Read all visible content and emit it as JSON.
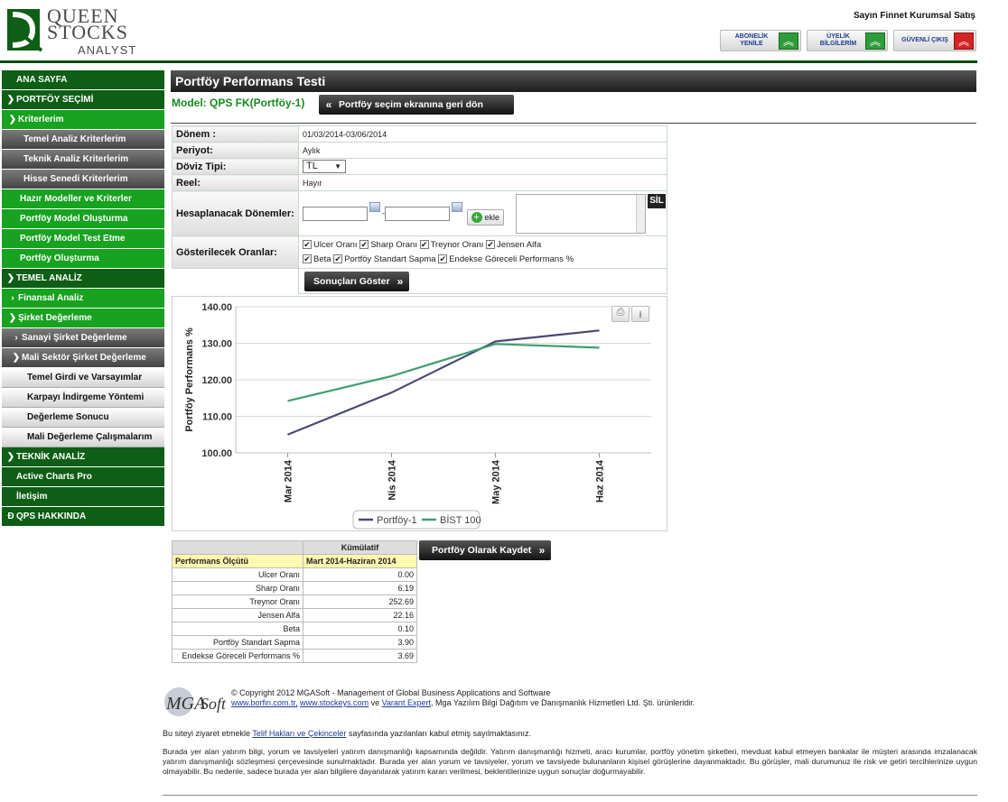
{
  "logo": {
    "line1": "QUEEN",
    "line2": "STOCKS",
    "line3": "ANALYST"
  },
  "header": {
    "user": "Sayın Finnet Kurumsal Satış",
    "buttons": [
      {
        "label": "ABONELİK YENİLE"
      },
      {
        "label": "ÜYELİK BİLGİLERİM"
      },
      {
        "label": "GÜVENLİ ÇIKIŞ"
      }
    ]
  },
  "sidebar": {
    "items": [
      {
        "label": "ANA SAYFA"
      },
      {
        "label": "PORTFÖY SEÇİMİ"
      },
      {
        "label": "Kriterlerim"
      },
      {
        "label": "Temel Analiz Kriterlerim"
      },
      {
        "label": "Teknik Analiz Kriterlerim"
      },
      {
        "label": "Hisse Senedi Kriterlerim"
      },
      {
        "label": "Hazır Modeller ve Kriterler"
      },
      {
        "label": "Portföy Model Oluşturma"
      },
      {
        "label": "Portföy Model Test Etme"
      },
      {
        "label": "Portföy Oluşturma"
      },
      {
        "label": "TEMEL ANALİZ"
      },
      {
        "label": "Finansal Analiz"
      },
      {
        "label": "Şirket Değerleme"
      },
      {
        "label": "Sanayi Şirket Değerleme"
      },
      {
        "label": "Mali Sektör Şirket Değerleme"
      },
      {
        "label": "Temel Girdi ve Varsayımlar"
      },
      {
        "label": "Karpayı İndirgeme Yöntemi"
      },
      {
        "label": "Değerleme Sonucu"
      },
      {
        "label": "Mali Değerleme Çalışmalarım"
      },
      {
        "label": "TEKNİK ANALİZ"
      },
      {
        "label": "Active Charts Pro"
      },
      {
        "label": "İletişim"
      },
      {
        "label": "QPS HAKKINDA"
      }
    ]
  },
  "page": {
    "title": "Portföy Performans Testi",
    "model": "Model: QPS FK(Portföy-1)",
    "back_button": "Portföy seçim ekranına geri dön"
  },
  "form": {
    "donem_label": "Dönem :",
    "donem_value": "01/03/2014-03/06/2014",
    "periyot_label": "Periyot:",
    "periyot_value": "Aylık",
    "doviz_label": "Döviz Tipi:",
    "doviz_value": "TL",
    "reel_label": "Reel:",
    "reel_value": "Hayır",
    "hesap_label": "Hesaplanacak Dönemler:",
    "ekle": "ekle",
    "sil": "SİL",
    "oran_label": "Gösterilecek Oranlar:",
    "oranlar": [
      "Ulcer Oranı",
      "Sharp Oranı",
      "Treynor Oranı",
      "Jensen Alfa",
      "Beta",
      "Portföy Standart Sapma",
      "Endekse Göreceli Performans %"
    ],
    "submit": "Sonuçları Göster"
  },
  "chart_data": {
    "type": "line",
    "categories": [
      "Mar 2014",
      "Nis 2014",
      "May 2014",
      "Haz 2014"
    ],
    "series": [
      {
        "name": "Portföy-1",
        "values": [
          105.0,
          116.5,
          130.5,
          133.5
        ],
        "color": "#4a4a75"
      },
      {
        "name": "BİST 100",
        "values": [
          114.2,
          121.0,
          129.8,
          128.8
        ],
        "color": "#3f9e72"
      }
    ],
    "ylabel": "Portföy Performans %",
    "yticks": [
      "100.00",
      "110.00",
      "120.00",
      "130.00",
      "140.00"
    ],
    "ylim": [
      100,
      140
    ],
    "legend": "bottom"
  },
  "results": {
    "col_header": "Kümülatif",
    "row_header": "Performans Ölçütü",
    "period": "Mart 2014-Haziran 2014",
    "rows": [
      {
        "name": "Ulcer Oranı",
        "value": "0.00"
      },
      {
        "name": "Sharp Oranı",
        "value": "6.19"
      },
      {
        "name": "Treynor Oranı",
        "value": "252.69"
      },
      {
        "name": "Jensen Alfa",
        "value": "22.16"
      },
      {
        "name": "Beta",
        "value": "0.10"
      },
      {
        "name": "Portföy Standart Sapma",
        "value": "3.90"
      },
      {
        "name": "Endekse Göreceli Performans %",
        "value": "3.69"
      }
    ],
    "save_button": "Portföy Olarak Kaydet"
  },
  "footer": {
    "logo_text": "MGASoft",
    "copyright": "© Copyright 2012 MGASoft - Management of Global Business Applications and Software",
    "link1": "www.borfin.com.tr,",
    "link2": "www.stockeys.com",
    "ve": " ve ",
    "link3": "Varant Expert",
    "tail": ", Mga Yazılım Bilgi Dağıtım ve Danışmanlık Hizmetleri Ltd. Şti. ürünleridir.",
    "terms_pre": "Bu siteyi ziyaret etmekle ",
    "terms_link": "Telif Hakları ve Çekinceler",
    "terms_post": " sayfasında yazılanları kabul etmiş sayılmaktasınız.",
    "disclaimer": "Burada yer alan yatırım bilgi, yorum ve tavsiyeleri yatırım danışmanlığı kapsamında değildir. Yatırım danışmanlığı hizmeti, aracı kurumlar, portföy yönetim şirketleri, mevduat kabul etmeyen bankalar ile müşteri arasında imzalanacak yatırım danışmanlığı sözleşmesi çerçevesinde sunulmaktadır. Burada yer alan yorum ve tavsiyeler, yorum ve tavsiyede bulunanların kişisel görüşlerine dayanmaktadır. Bu görüşler, mali durumunuz ile risk ve getiri tercihlerinize uygun olmayabilir. Bu nedenle, sadece burada yer alan bilgilere dayanılarak yatırım kararı verilmesi, beklentilerinize uygun sonuçlar doğurmayabilir."
  }
}
